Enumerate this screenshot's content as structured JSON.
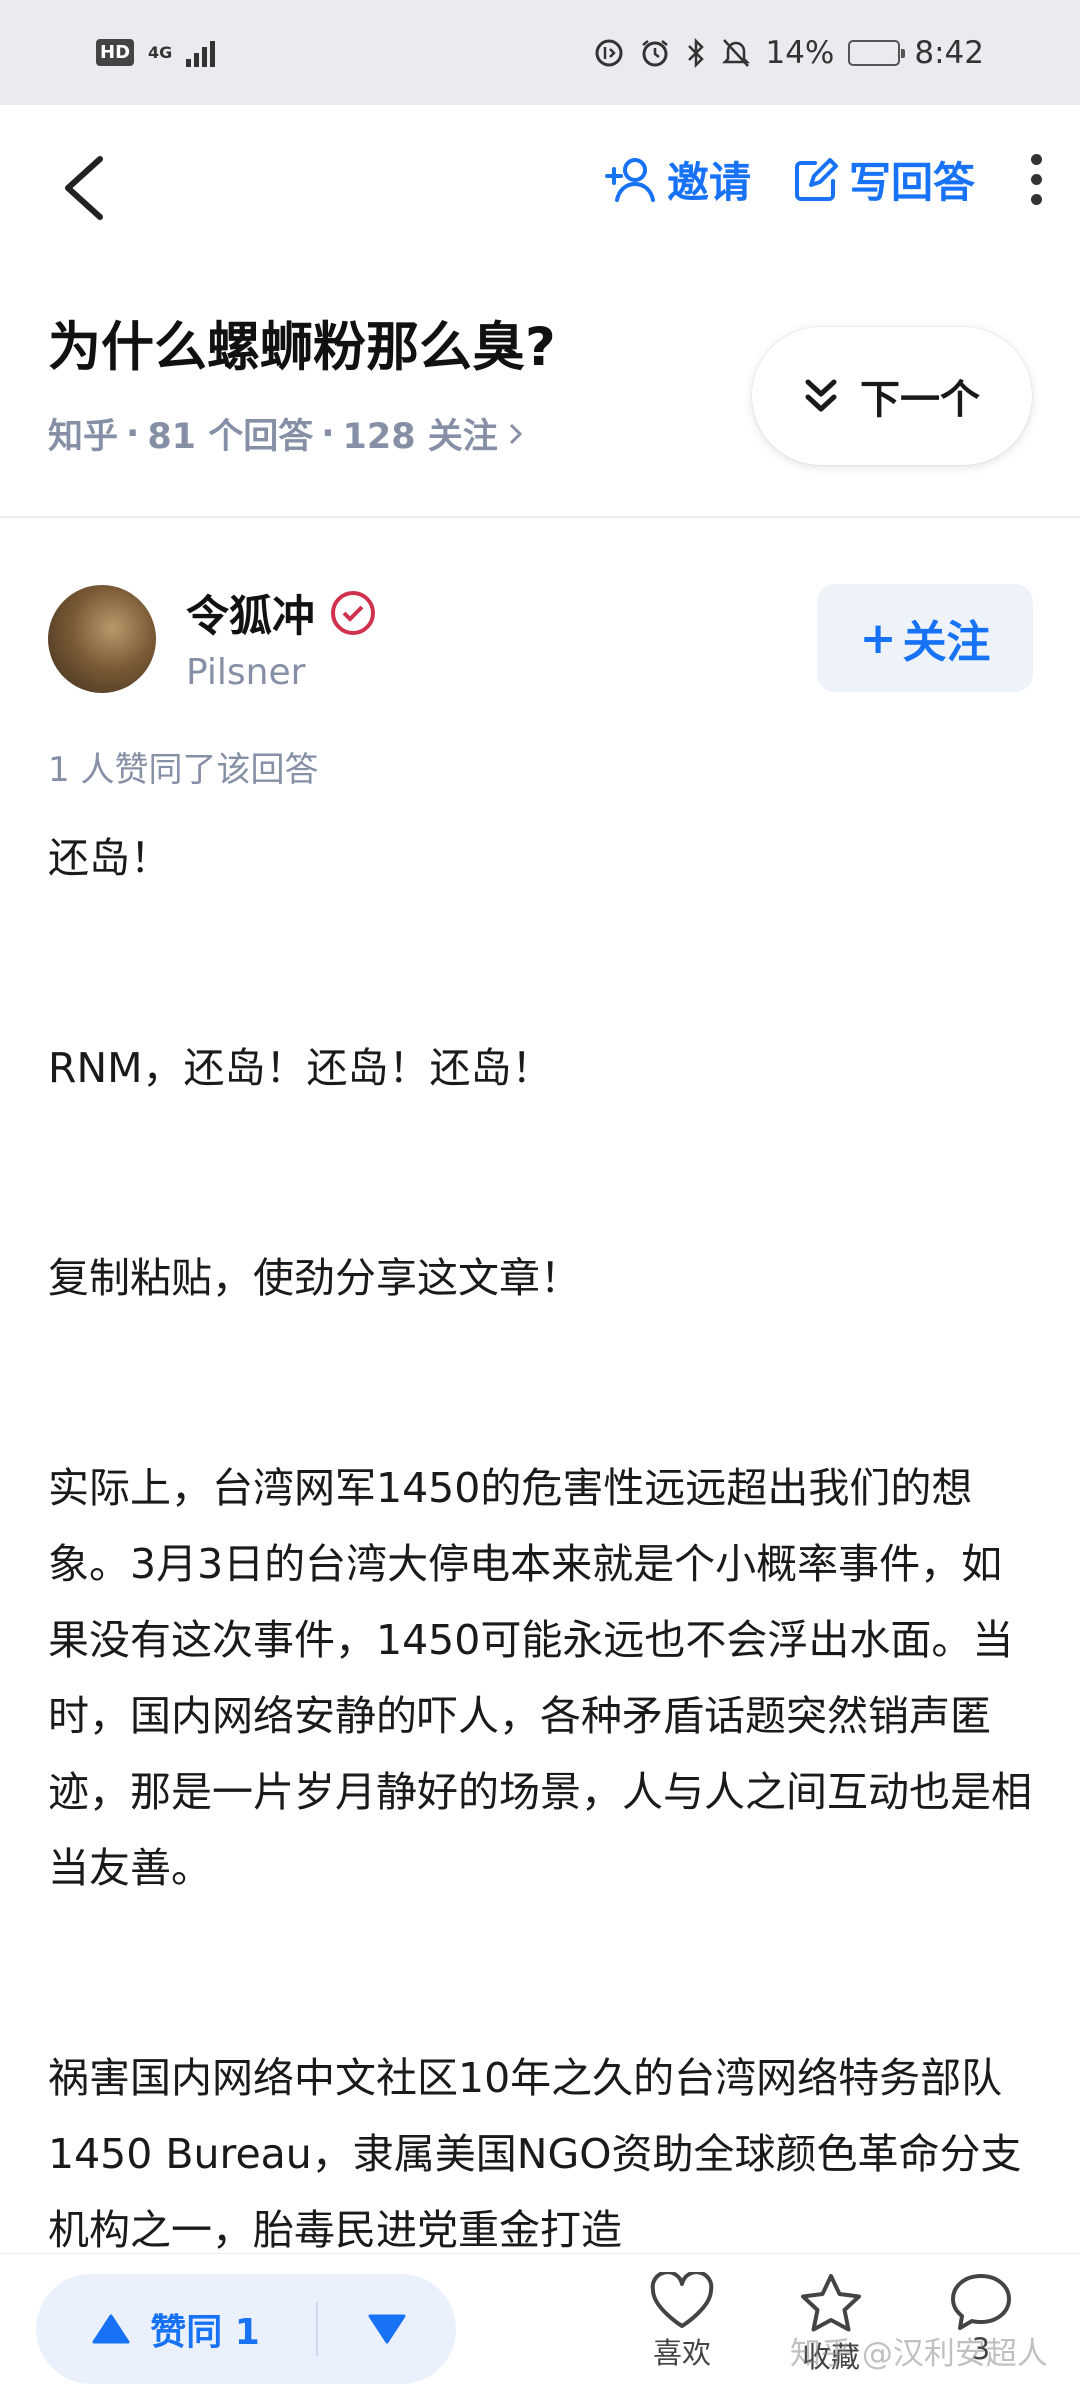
{
  "status_bar": {
    "hd": "HD",
    "network": "4G",
    "battery": "14%",
    "time": "8:42",
    "battery_level": 0.14,
    "battery_color": "#f5a623"
  },
  "nav": {
    "invite_label": "邀请",
    "write_answer_label": "写回答",
    "accent_color": "#1772f6"
  },
  "question": {
    "title": "为什么螺蛳粉那么臭?",
    "source": "知乎",
    "answers_count": "81 个回答",
    "follows_count": "128 关注",
    "sep": "·",
    "next_label": "下一个"
  },
  "author": {
    "name": "令狐冲",
    "bio": "Pilsner",
    "follow_label": "关注",
    "follow_plus": "+"
  },
  "answer": {
    "upvote_summary": "1 人赞同了该回答",
    "paragraphs": [
      "还岛！",
      "RNM，还岛！还岛！还岛！",
      "复制粘贴，使劲分享这文章！",
      "实际上，台湾网军1450的危害性远远超出我们的想象。3月3日的台湾大停电本来就是个小概率事件，如果没有这次事件，1450可能永远也不会浮出水面。当时，国内网络安静的吓人，各种矛盾话题突然销声匿迹，那是一片岁月静好的场景，人与人之间互动也是相当友善。",
      "祸害国内网络中文社区10年之久的台湾网络特务部队1450 Bureau，隶属美国NGO资助全球颜色革命分支机构之一，胎毒民进党重金打造"
    ]
  },
  "bottom_bar": {
    "upvote_label": "赞同 1",
    "like_label": "喜欢",
    "collect_label": "收藏",
    "comment_count": "3",
    "watermark": "知乎 @汉利安超人"
  }
}
